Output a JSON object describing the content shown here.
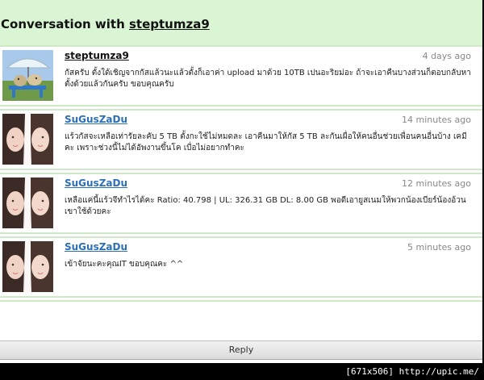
{
  "header": {
    "title_prefix": "Conversation with",
    "title_user": "steptumza9"
  },
  "messages": [
    {
      "author": "steptumza9",
      "time": "4 days ago",
      "body": "กัสครับ ตั้งใด้เชิญจากกัสแล้วนะแล้วตั้งก็เอาค่า upload มาด้วย 10TB เปนอะริยม่อะ ถ้าจะเอาคืนบางส่วนก็ตอบกลับหาตั้งด้วยแล้วกันครับ ขอบคุณครับ",
      "avatar_icon": "dog-umbrella-avatar"
    },
    {
      "author": "SuGusZaDu",
      "time": "14 minutes ago",
      "body": "แร้วกัสจะเหลือเท่ารัยละคับ 5 TB ตั้งกะใช้ไม่หมดละ เอาคืนมาให้กัส 5 TB ละกันเผื่อให้คนอื่นช่วยเพื่อนคนอื่นบ้าง เคมีคะ เพราะช่วงนี้ไม่ได้อัพงานขึ้นโค เบื่อไม่อยากทำคะ",
      "avatar_icon": "girl-photo-avatar"
    },
    {
      "author": "SuGusZaDu",
      "time": "12 minutes ago",
      "body": "เหลือแค่นี้แร้วจึทำไรได้คะ  Ratio: 40.798 | UL: 326.31 GB DL: 8.00 GB พอดีเอายูสเนมให้พวกน้องเบียร์น้องอ้วนเขาใช้ด้วยคะ",
      "avatar_icon": "girl-photo-avatar"
    },
    {
      "author": "SuGusZaDu",
      "time": "5 minutes ago",
      "body": "เข้าจัยนะคะคุณIT ขอบคุณคะ ^^",
      "avatar_icon": "girl-photo-avatar"
    }
  ],
  "reply_label": "Reply",
  "watermark": "[671x506] http://upic.me/",
  "colors": {
    "header_bg": "#d9f5d3",
    "author_link": "#2b6fb6",
    "divider": "#cfe8c8"
  }
}
